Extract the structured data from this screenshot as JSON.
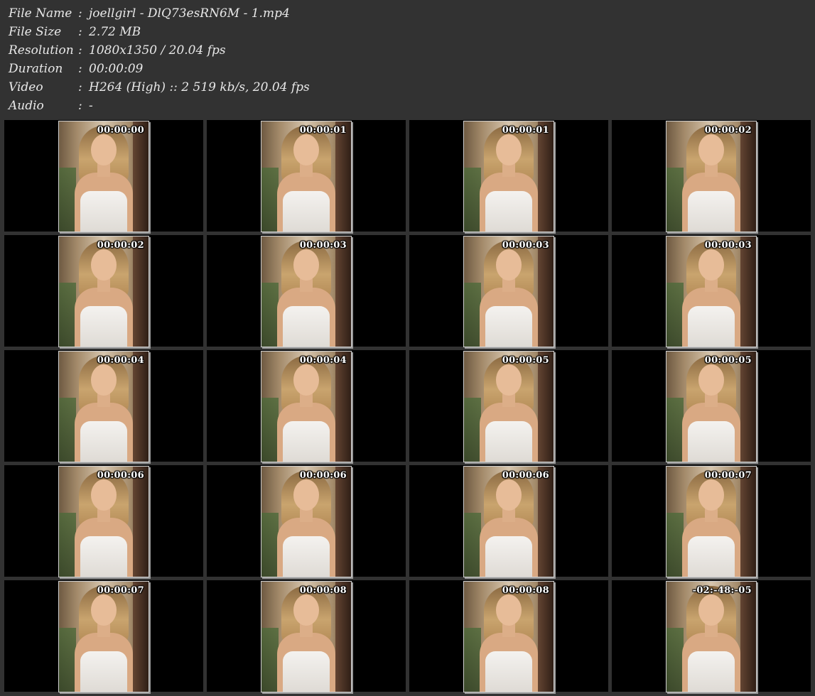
{
  "info": [
    {
      "label": "File Name",
      "sep": ":",
      "value": "joellgirl - DlQ73esRN6M - 1.mp4"
    },
    {
      "label": "File Size",
      "sep": ":",
      "value": "2.72 MB"
    },
    {
      "label": "Resolution",
      "sep": ":",
      "value": "1080x1350 / 20.04 fps"
    },
    {
      "label": "Duration",
      "sep": ":",
      "value": "00:00:09"
    },
    {
      "label": "Video",
      "sep": ":",
      "value": "H264 (High) :: 2 519 kb/s, 20.04 fps"
    },
    {
      "label": "Audio",
      "sep": ":",
      "value": "-"
    }
  ],
  "thumbnails": [
    {
      "timestamp": "00:00:00"
    },
    {
      "timestamp": "00:00:01"
    },
    {
      "timestamp": "00:00:01"
    },
    {
      "timestamp": "00:00:02"
    },
    {
      "timestamp": "00:00:02"
    },
    {
      "timestamp": "00:00:03"
    },
    {
      "timestamp": "00:00:03"
    },
    {
      "timestamp": "00:00:03"
    },
    {
      "timestamp": "00:00:04"
    },
    {
      "timestamp": "00:00:04"
    },
    {
      "timestamp": "00:00:05"
    },
    {
      "timestamp": "00:00:05"
    },
    {
      "timestamp": "00:00:06"
    },
    {
      "timestamp": "00:00:06"
    },
    {
      "timestamp": "00:00:06"
    },
    {
      "timestamp": "00:00:07"
    },
    {
      "timestamp": "00:00:07"
    },
    {
      "timestamp": "00:00:08"
    },
    {
      "timestamp": "00:00:08"
    },
    {
      "timestamp": "-02:-48:-05"
    }
  ],
  "colors": {
    "background": "#323232",
    "cell": "#000000",
    "text": "#e8e8e8",
    "timestamp": "#ffffff"
  }
}
